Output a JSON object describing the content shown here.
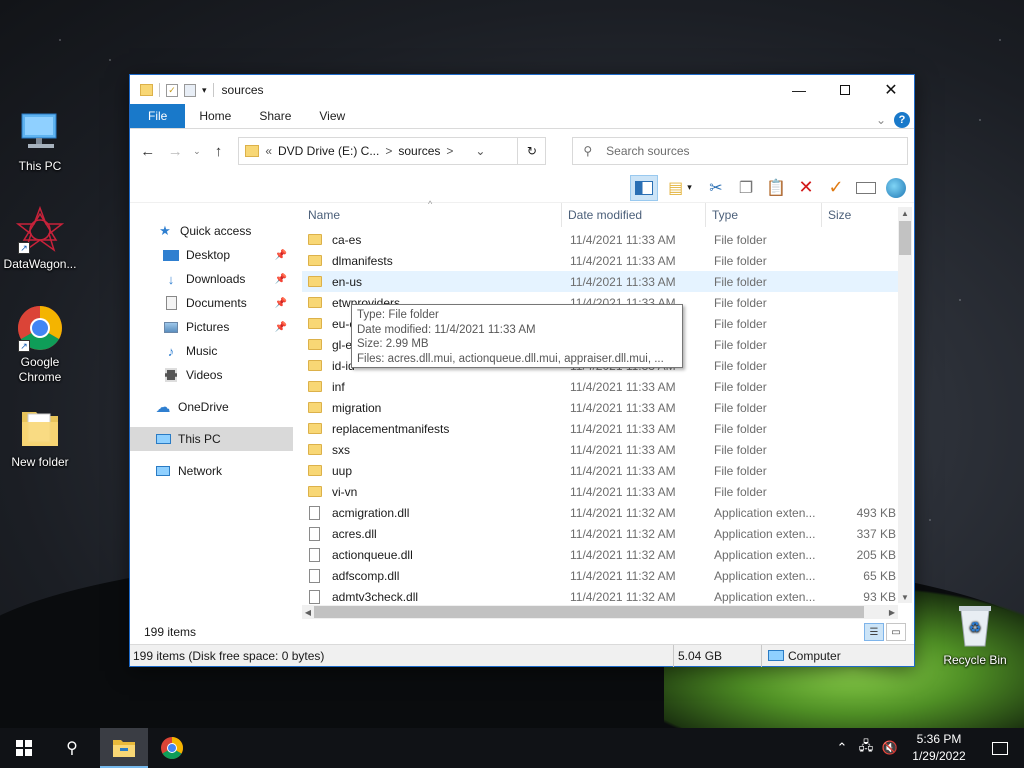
{
  "desktop": {
    "icons": [
      {
        "label": "This PC",
        "icon": "this-pc-icon"
      },
      {
        "label": "DataWagon...",
        "icon": "datawagon-icon"
      },
      {
        "label": "Google Chrome",
        "icon": "chrome-icon"
      },
      {
        "label": "New folder",
        "icon": "folder-icon"
      },
      {
        "label": "Recycle Bin",
        "icon": "recycle-bin-icon"
      }
    ]
  },
  "window": {
    "title": "sources",
    "ribbon_tabs": [
      "File",
      "Home",
      "Share",
      "View"
    ],
    "address": {
      "prefix": "«",
      "path1": "DVD Drive (E:) C...",
      "sep": ">",
      "path2": "sources"
    },
    "search_placeholder": "Search sources",
    "nav_pane": {
      "quick_access": "Quick access",
      "quick_items": [
        "Desktop",
        "Downloads",
        "Documents",
        "Pictures",
        "Music",
        "Videos"
      ],
      "onedrive": "OneDrive",
      "this_pc": "This PC",
      "network": "Network"
    },
    "columns": {
      "name": "Name",
      "date": "Date modified",
      "type": "Type",
      "size": "Size"
    },
    "rows": [
      {
        "name": "ca-es",
        "date": "11/4/2021 11:33 AM",
        "type": "File folder",
        "size": "",
        "kind": "folder"
      },
      {
        "name": "dlmanifests",
        "date": "11/4/2021 11:33 AM",
        "type": "File folder",
        "size": "",
        "kind": "folder"
      },
      {
        "name": "en-us",
        "date": "11/4/2021 11:33 AM",
        "type": "File folder",
        "size": "",
        "kind": "folder"
      },
      {
        "name": "etwproviders",
        "date": "11/4/2021 11:33 AM",
        "type": "File folder",
        "size": "",
        "kind": "folder"
      },
      {
        "name": "eu-es",
        "date": "11/4/2021 11:33 AM",
        "type": "File folder",
        "size": "",
        "kind": "folder"
      },
      {
        "name": "gl-es",
        "date": "11/4/2021 11:33 AM",
        "type": "File folder",
        "size": "",
        "kind": "folder"
      },
      {
        "name": "id-id",
        "date": "11/4/2021 11:33 AM",
        "type": "File folder",
        "size": "",
        "kind": "folder"
      },
      {
        "name": "inf",
        "date": "11/4/2021 11:33 AM",
        "type": "File folder",
        "size": "",
        "kind": "folder"
      },
      {
        "name": "migration",
        "date": "11/4/2021 11:33 AM",
        "type": "File folder",
        "size": "",
        "kind": "folder"
      },
      {
        "name": "replacementmanifests",
        "date": "11/4/2021 11:33 AM",
        "type": "File folder",
        "size": "",
        "kind": "folder"
      },
      {
        "name": "sxs",
        "date": "11/4/2021 11:33 AM",
        "type": "File folder",
        "size": "",
        "kind": "folder"
      },
      {
        "name": "uup",
        "date": "11/4/2021 11:33 AM",
        "type": "File folder",
        "size": "",
        "kind": "folder"
      },
      {
        "name": "vi-vn",
        "date": "11/4/2021 11:33 AM",
        "type": "File folder",
        "size": "",
        "kind": "folder"
      },
      {
        "name": "acmigration.dll",
        "date": "11/4/2021 11:32 AM",
        "type": "Application exten...",
        "size": "493 KB",
        "kind": "file"
      },
      {
        "name": "acres.dll",
        "date": "11/4/2021 11:32 AM",
        "type": "Application exten...",
        "size": "337 KB",
        "kind": "file"
      },
      {
        "name": "actionqueue.dll",
        "date": "11/4/2021 11:32 AM",
        "type": "Application exten...",
        "size": "205 KB",
        "kind": "file"
      },
      {
        "name": "adfscomp.dll",
        "date": "11/4/2021 11:32 AM",
        "type": "Application exten...",
        "size": "65 KB",
        "kind": "file"
      },
      {
        "name": "admtv3check.dll",
        "date": "11/4/2021 11:32 AM",
        "type": "Application exten...",
        "size": "93 KB",
        "kind": "file"
      }
    ],
    "tooltip": {
      "type": "Type: File folder",
      "date": "Date modified: 11/4/2021 11:33 AM",
      "size": "Size: 2.99 MB",
      "files": "Files: acres.dll.mui, actionqueue.dll.mui, appraiser.dll.mui, ..."
    },
    "item_count": "199 items",
    "status": {
      "left": "199 items (Disk free space: 0 bytes)",
      "size": "5.04 GB",
      "location": "Computer"
    }
  },
  "taskbar": {
    "time": "5:36 PM",
    "date": "1/29/2022"
  },
  "colors": {
    "accent": "#1979ca",
    "folder": "#f8d775",
    "hover_row": "#e5f3ff"
  }
}
